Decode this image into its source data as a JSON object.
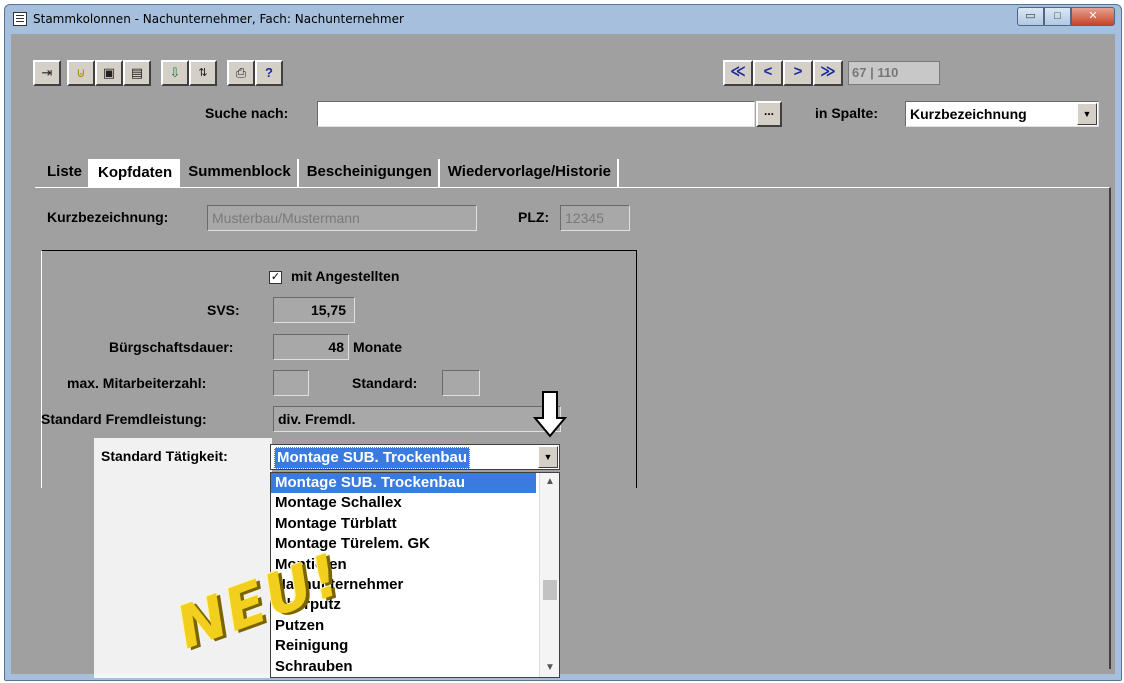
{
  "window": {
    "title": "Stammkolonnen - Nachunternehmer, Fach: Nachunternehmer",
    "min_glyph": "▭",
    "max_glyph": "□",
    "close_glyph": "✕"
  },
  "toolbar": {
    "icons": [
      "exit-icon",
      "attach-icon",
      "save-icon",
      "calculator-icon",
      "export-icon",
      "sort-az-icon",
      "print-icon",
      "help-icon"
    ],
    "nav": {
      "first": "≪",
      "prev": "<",
      "next": ">",
      "last": "≫"
    },
    "record_counter": "67 | 110"
  },
  "search": {
    "label": "Suche nach:",
    "value": "",
    "dots_label": "...",
    "column_label": "in Spalte:",
    "column_value": "Kurzbezeichnung"
  },
  "tabs": [
    {
      "label": "Liste",
      "active": false
    },
    {
      "label": "Kopfdaten",
      "active": true
    },
    {
      "label": "Summenblock",
      "active": false
    },
    {
      "label": "Bescheinigungen",
      "active": false
    },
    {
      "label": "Wiedervorlage/Historie",
      "active": false
    }
  ],
  "form": {
    "kurzbezeichnung_label": "Kurzbezeichnung:",
    "kurzbezeichnung_value": "Musterbau/Mustermann",
    "plz_label": "PLZ:",
    "plz_value": "12345",
    "mit_angestellten_label": "mit Angestellten",
    "mit_angestellten_checked": true,
    "svs_label": "SVS:",
    "svs_value": "15,75",
    "buergschaft_label": "Bürgschaftsdauer:",
    "buergschaft_value": "48",
    "buergschaft_unit": "Monate",
    "max_mitarbeiter_label": "max. Mitarbeiterzahl:",
    "max_mitarbeiter_value": "",
    "standard_label": "Standard:",
    "standard_value": "",
    "fremdleistung_label": "Standard Fremdleistung:",
    "fremdleistung_value": "div. Fremdl.",
    "taetigkeit_label": "Standard Tätigkeit:",
    "taetigkeit_value": "Montage SUB. Trockenbau"
  },
  "dropdown": {
    "items": [
      "Montage SUB. Trockenbau",
      "Montage Schallex",
      "Montage Türblatt",
      "Montage Türelem. GK",
      "Montieren",
      "Nachunternehmer",
      "Oberputz",
      "Putzen",
      "Reinigung",
      "Schrauben"
    ],
    "selected_index": 0
  },
  "overlay": {
    "stamp_text": "NEU!"
  }
}
